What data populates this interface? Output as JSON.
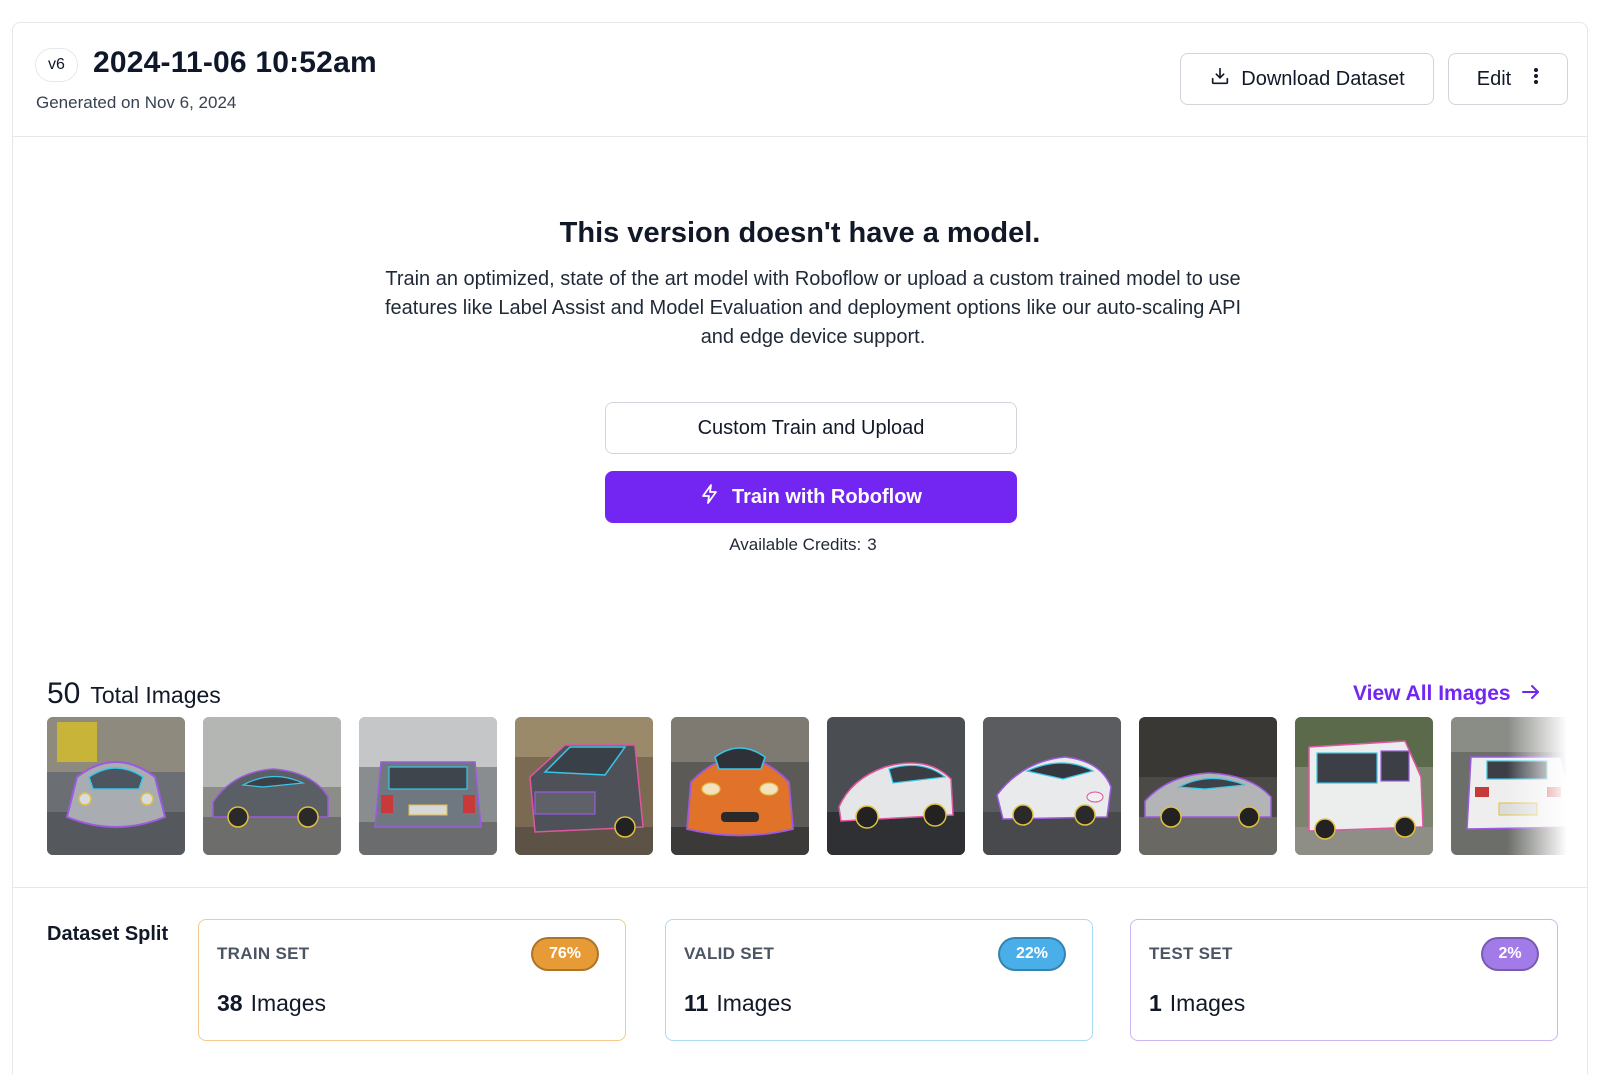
{
  "header": {
    "version_badge": "v6",
    "title": "2024-11-06 10:52am",
    "generated": "Generated on Nov 6, 2024",
    "download_label": "Download Dataset",
    "edit_label": "Edit"
  },
  "empty_state": {
    "title": "This version doesn't have a model.",
    "description": "Train an optimized, state of the art model with Roboflow or upload a custom trained model to use features like Label Assist and Model Evaluation and deployment options like our auto-scaling API and edge device support.",
    "custom_train_label": "Custom Train and Upload",
    "train_label": "Train with Roboflow",
    "credits_label": "Available Credits:",
    "credits_value": "3"
  },
  "images": {
    "total_count": "50",
    "total_label": "Total Images",
    "view_all_label": "View All Images",
    "thumbnails": [
      {
        "name": "thumbnail-1"
      },
      {
        "name": "thumbnail-2"
      },
      {
        "name": "thumbnail-3"
      },
      {
        "name": "thumbnail-4"
      },
      {
        "name": "thumbnail-5"
      },
      {
        "name": "thumbnail-6"
      },
      {
        "name": "thumbnail-7"
      },
      {
        "name": "thumbnail-8"
      },
      {
        "name": "thumbnail-9"
      },
      {
        "name": "thumbnail-10"
      }
    ]
  },
  "split": {
    "label": "Dataset Split",
    "sets": [
      {
        "name": "TRAIN SET",
        "percent": "76%",
        "count": "38",
        "unit": "Images",
        "color": "#e69b37",
        "border": "#f3c98e"
      },
      {
        "name": "VALID SET",
        "percent": "22%",
        "count": "11",
        "unit": "Images",
        "color": "#4aaee8",
        "border": "#a9dcf4"
      },
      {
        "name": "TEST SET",
        "percent": "2%",
        "count": "1",
        "unit": "Images",
        "color": "#a27be9",
        "border": "#cbb5f2"
      }
    ]
  },
  "colors": {
    "accent": "#7326f2"
  },
  "icons": {
    "download": "download-icon",
    "more": "more-vertical-icon",
    "train": "lightning-icon",
    "arrow": "arrow-right-icon"
  }
}
